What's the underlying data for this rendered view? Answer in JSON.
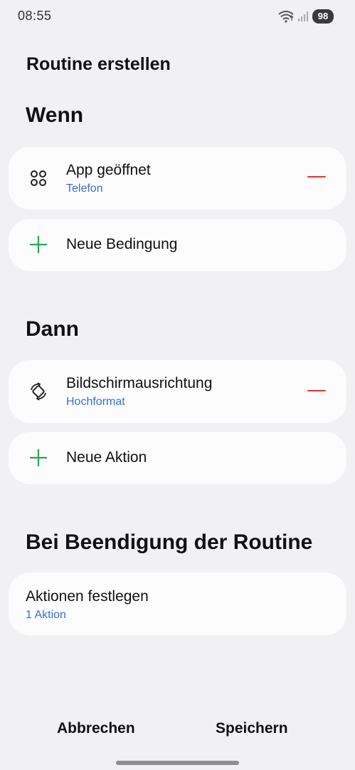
{
  "status_bar": {
    "time": "08:55",
    "battery": "98"
  },
  "page": {
    "title": "Routine erstellen"
  },
  "if_section": {
    "title": "Wenn",
    "condition": {
      "title": "App geöffnet",
      "subtitle": "Telefon",
      "icon": "apps-grid-icon"
    },
    "add_label": "Neue Bedingung"
  },
  "then_section": {
    "title": "Dann",
    "action": {
      "title": "Bildschirmausrichtung",
      "subtitle": "Hochformat",
      "icon": "screen-rotation-icon"
    },
    "add_label": "Neue Aktion"
  },
  "end_section": {
    "title": "Bei Beendigung der Routine",
    "item": {
      "title": "Aktionen festlegen",
      "subtitle": "1 Aktion"
    }
  },
  "footer": {
    "cancel_label": "Abbrechen",
    "save_label": "Speichern"
  },
  "colors": {
    "accent_blue": "#3a6fd0",
    "remove_red": "#e0332f",
    "add_green": "#2aa55a",
    "background": "#f1f1f3"
  }
}
